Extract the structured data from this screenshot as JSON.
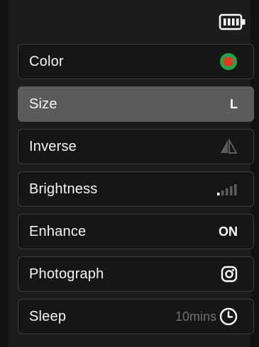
{
  "status": {
    "battery_icon": "battery-full-icon"
  },
  "menu": {
    "items": [
      {
        "label": "Color",
        "icon": "color-dot-icon",
        "colors": {
          "ring": "#1ea64b",
          "dot": "#e8371e"
        }
      },
      {
        "label": "Size",
        "value": "L",
        "selected": true
      },
      {
        "label": "Inverse",
        "icon": "mirror-flip-icon"
      },
      {
        "label": "Brightness",
        "icon": "brightness-level-icon",
        "level": 1,
        "max_level": 5
      },
      {
        "label": "Enhance",
        "value": "ON"
      },
      {
        "label": "Photograph",
        "icon": "camera-icon"
      },
      {
        "label": "Sleep",
        "value": "10mins",
        "icon": "clock-icon"
      }
    ]
  },
  "colors": {
    "background": "#1c1c1c",
    "item_background": "#161616",
    "item_border": "#3c3c3c",
    "selected_background": "#5b5b5b",
    "muted_text": "#6f6f6f"
  }
}
